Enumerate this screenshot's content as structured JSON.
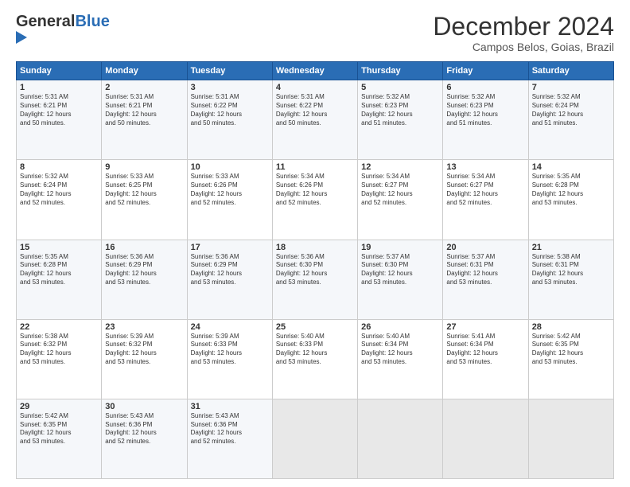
{
  "header": {
    "logo_line1": "General",
    "logo_line2": "Blue",
    "month": "December 2024",
    "location": "Campos Belos, Goias, Brazil"
  },
  "weekdays": [
    "Sunday",
    "Monday",
    "Tuesday",
    "Wednesday",
    "Thursday",
    "Friday",
    "Saturday"
  ],
  "weeks": [
    [
      {
        "day": "1",
        "info": "Sunrise: 5:31 AM\nSunset: 6:21 PM\nDaylight: 12 hours\nand 50 minutes."
      },
      {
        "day": "2",
        "info": "Sunrise: 5:31 AM\nSunset: 6:21 PM\nDaylight: 12 hours\nand 50 minutes."
      },
      {
        "day": "3",
        "info": "Sunrise: 5:31 AM\nSunset: 6:22 PM\nDaylight: 12 hours\nand 50 minutes."
      },
      {
        "day": "4",
        "info": "Sunrise: 5:31 AM\nSunset: 6:22 PM\nDaylight: 12 hours\nand 50 minutes."
      },
      {
        "day": "5",
        "info": "Sunrise: 5:32 AM\nSunset: 6:23 PM\nDaylight: 12 hours\nand 51 minutes."
      },
      {
        "day": "6",
        "info": "Sunrise: 5:32 AM\nSunset: 6:23 PM\nDaylight: 12 hours\nand 51 minutes."
      },
      {
        "day": "7",
        "info": "Sunrise: 5:32 AM\nSunset: 6:24 PM\nDaylight: 12 hours\nand 51 minutes."
      }
    ],
    [
      {
        "day": "8",
        "info": "Sunrise: 5:32 AM\nSunset: 6:24 PM\nDaylight: 12 hours\nand 52 minutes."
      },
      {
        "day": "9",
        "info": "Sunrise: 5:33 AM\nSunset: 6:25 PM\nDaylight: 12 hours\nand 52 minutes."
      },
      {
        "day": "10",
        "info": "Sunrise: 5:33 AM\nSunset: 6:26 PM\nDaylight: 12 hours\nand 52 minutes."
      },
      {
        "day": "11",
        "info": "Sunrise: 5:34 AM\nSunset: 6:26 PM\nDaylight: 12 hours\nand 52 minutes."
      },
      {
        "day": "12",
        "info": "Sunrise: 5:34 AM\nSunset: 6:27 PM\nDaylight: 12 hours\nand 52 minutes."
      },
      {
        "day": "13",
        "info": "Sunrise: 5:34 AM\nSunset: 6:27 PM\nDaylight: 12 hours\nand 52 minutes."
      },
      {
        "day": "14",
        "info": "Sunrise: 5:35 AM\nSunset: 6:28 PM\nDaylight: 12 hours\nand 53 minutes."
      }
    ],
    [
      {
        "day": "15",
        "info": "Sunrise: 5:35 AM\nSunset: 6:28 PM\nDaylight: 12 hours\nand 53 minutes."
      },
      {
        "day": "16",
        "info": "Sunrise: 5:36 AM\nSunset: 6:29 PM\nDaylight: 12 hours\nand 53 minutes."
      },
      {
        "day": "17",
        "info": "Sunrise: 5:36 AM\nSunset: 6:29 PM\nDaylight: 12 hours\nand 53 minutes."
      },
      {
        "day": "18",
        "info": "Sunrise: 5:36 AM\nSunset: 6:30 PM\nDaylight: 12 hours\nand 53 minutes."
      },
      {
        "day": "19",
        "info": "Sunrise: 5:37 AM\nSunset: 6:30 PM\nDaylight: 12 hours\nand 53 minutes."
      },
      {
        "day": "20",
        "info": "Sunrise: 5:37 AM\nSunset: 6:31 PM\nDaylight: 12 hours\nand 53 minutes."
      },
      {
        "day": "21",
        "info": "Sunrise: 5:38 AM\nSunset: 6:31 PM\nDaylight: 12 hours\nand 53 minutes."
      }
    ],
    [
      {
        "day": "22",
        "info": "Sunrise: 5:38 AM\nSunset: 6:32 PM\nDaylight: 12 hours\nand 53 minutes."
      },
      {
        "day": "23",
        "info": "Sunrise: 5:39 AM\nSunset: 6:32 PM\nDaylight: 12 hours\nand 53 minutes."
      },
      {
        "day": "24",
        "info": "Sunrise: 5:39 AM\nSunset: 6:33 PM\nDaylight: 12 hours\nand 53 minutes."
      },
      {
        "day": "25",
        "info": "Sunrise: 5:40 AM\nSunset: 6:33 PM\nDaylight: 12 hours\nand 53 minutes."
      },
      {
        "day": "26",
        "info": "Sunrise: 5:40 AM\nSunset: 6:34 PM\nDaylight: 12 hours\nand 53 minutes."
      },
      {
        "day": "27",
        "info": "Sunrise: 5:41 AM\nSunset: 6:34 PM\nDaylight: 12 hours\nand 53 minutes."
      },
      {
        "day": "28",
        "info": "Sunrise: 5:42 AM\nSunset: 6:35 PM\nDaylight: 12 hours\nand 53 minutes."
      }
    ],
    [
      {
        "day": "29",
        "info": "Sunrise: 5:42 AM\nSunset: 6:35 PM\nDaylight: 12 hours\nand 53 minutes."
      },
      {
        "day": "30",
        "info": "Sunrise: 5:43 AM\nSunset: 6:36 PM\nDaylight: 12 hours\nand 52 minutes."
      },
      {
        "day": "31",
        "info": "Sunrise: 5:43 AM\nSunset: 6:36 PM\nDaylight: 12 hours\nand 52 minutes."
      },
      {
        "day": "",
        "info": ""
      },
      {
        "day": "",
        "info": ""
      },
      {
        "day": "",
        "info": ""
      },
      {
        "day": "",
        "info": ""
      }
    ]
  ]
}
